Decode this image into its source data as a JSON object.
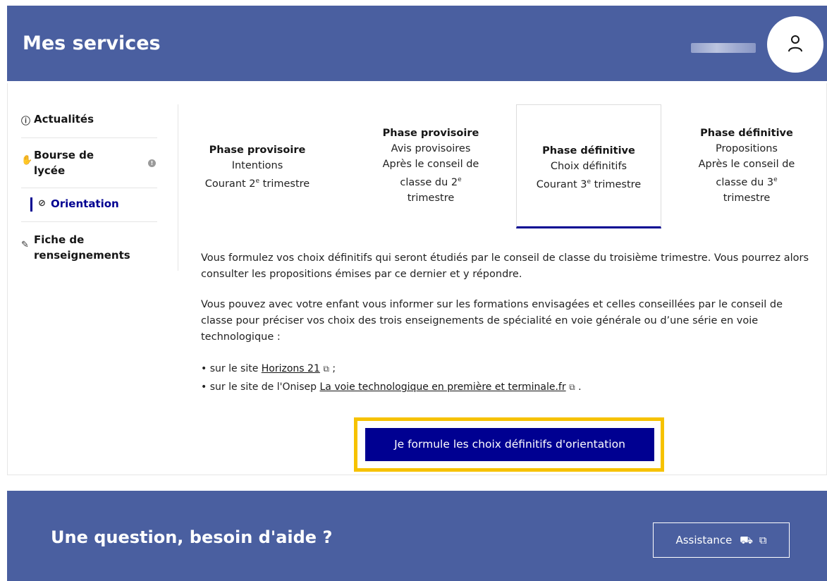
{
  "header": {
    "title": "Mes services",
    "user_icon": "user-icon"
  },
  "sidebar": {
    "items": [
      {
        "label": "Actualités",
        "icon": "info-icon"
      },
      {
        "label": "Bourse de lycée",
        "line1": "Bourse de",
        "line2": "lycée",
        "icon": "hand-coins-icon",
        "badge": "!"
      },
      {
        "label": "Orientation",
        "icon": "compass-icon",
        "active": true
      },
      {
        "label": "Fiche de renseignements",
        "line1": "Fiche de",
        "line2": "renseignements",
        "icon": "edit-icon"
      }
    ]
  },
  "tabs": [
    {
      "title": "Phase provisoire",
      "line1": "Intentions",
      "line2": "Courant 2",
      "sup": "e",
      "line2_end": " trimestre"
    },
    {
      "title": "Phase provisoire",
      "line1": "Avis provisoires",
      "line2": "Après le conseil de",
      "line3": "classe du 2",
      "sup": "e",
      "line4": "trimestre"
    },
    {
      "title": "Phase définitive",
      "line1": "Choix définitifs",
      "line2": "Courant 3",
      "sup": "e",
      "line2_end": " trimestre",
      "selected": true
    },
    {
      "title": "Phase définitive",
      "line1": "Propositions",
      "line2": "Après le conseil de",
      "line3": "classe du 3",
      "sup": "e",
      "line4": "trimestre"
    }
  ],
  "content": {
    "para1": "Vous formulez vos choix définitifs qui seront étudiés par le conseil de classe du troisième trimestre. Vous pourrez alors consulter les propositions émises par ce dernier et y répondre.",
    "para2": "Vous pouvez avec votre enfant vous informer sur les formations envisagées et celles conseillées par le conseil de classe pour préciser vos choix des trois enseignements de spécialité en voie générale ou d’une série en voie technologique :",
    "bullet1_prefix": "• sur le site ",
    "bullet1_link": "Horizons 21",
    "bullet1_suffix": " ;",
    "bullet2_prefix": "• sur le site de l'Onisep ",
    "bullet2_link": "La voie technologique en première et terminale.fr",
    "bullet2_suffix": " .",
    "external_icon": "external-link-icon"
  },
  "cta": {
    "label": "Je formule les choix définitifs d'orientation"
  },
  "footer": {
    "title": "Une question, besoin d'aide ?",
    "assist_label": "Assistance",
    "assist_icon": "support-icon"
  },
  "colors": {
    "header_bg": "#4a5fa0",
    "primary": "#000091",
    "highlight": "#f6c200"
  }
}
